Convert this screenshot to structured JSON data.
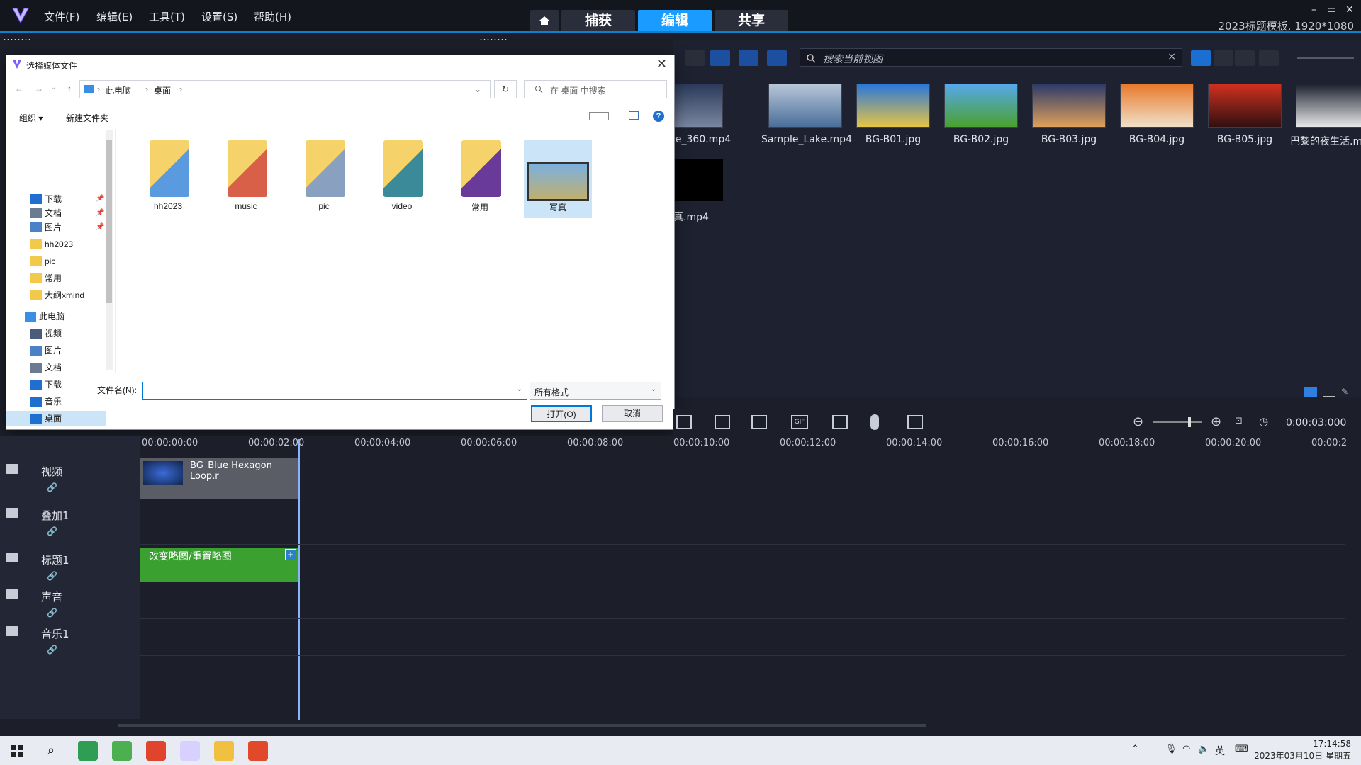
{
  "app": {
    "menu": [
      "文件(F)",
      "编辑(E)",
      "工具(T)",
      "设置(S)",
      "帮助(H)"
    ],
    "tabs": [
      {
        "label": "捕获",
        "active": false
      },
      {
        "label": "编辑",
        "active": true
      },
      {
        "label": "共享",
        "active": false
      }
    ],
    "project_info": "2023标题模板, 1920*1080",
    "accent": "#1a9bff"
  },
  "library": {
    "search_placeholder": "搜索当前视图",
    "items": [
      {
        "label": "e_360.mp4",
        "colors": [
          "#2b3a5a",
          "#7a86a0"
        ]
      },
      {
        "label": "Sample_Lake.mp4",
        "colors": [
          "#b8c6d8",
          "#4a6f9a"
        ]
      },
      {
        "label": "BG-B01.jpg",
        "colors": [
          "#2a78d8",
          "#e6c447"
        ]
      },
      {
        "label": "BG-B02.jpg",
        "colors": [
          "#56a8ea",
          "#4aa12e"
        ]
      },
      {
        "label": "BG-B03.jpg",
        "colors": [
          "#2c3a6a",
          "#e0a05a"
        ]
      },
      {
        "label": "BG-B04.jpg",
        "colors": [
          "#e87a2c",
          "#f0e0c8"
        ]
      },
      {
        "label": "BG-B05.jpg",
        "colors": [
          "#d03020",
          "#301010"
        ]
      },
      {
        "label": "巴黎的夜生活.mp3",
        "colors": [
          "#1e2230",
          "#e8e8e8"
        ]
      }
    ],
    "second_row_label": "真.mp4"
  },
  "dialog": {
    "title": "选择媒体文件",
    "breadcrumb": [
      "此电脑",
      "桌面"
    ],
    "search_placeholder": "在 桌面 中搜索",
    "toolbar": {
      "organize": "组织 ▾",
      "new_folder": "新建文件夹"
    },
    "nav": [
      {
        "label": "下载",
        "icon": "download-icon",
        "pinned": true
      },
      {
        "label": "文档",
        "icon": "document-icon",
        "pinned": true
      },
      {
        "label": "图片",
        "icon": "picture-icon",
        "pinned": true
      },
      {
        "label": "hh2023",
        "icon": "folder-icon",
        "pinned": false
      },
      {
        "label": "pic",
        "icon": "folder-icon",
        "pinned": false
      },
      {
        "label": "常用",
        "icon": "folder-icon",
        "pinned": false
      },
      {
        "label": "大纲xmind",
        "icon": "folder-icon",
        "pinned": false
      },
      {
        "label": "此电脑",
        "icon": "computer-icon",
        "pinned": false
      },
      {
        "label": "视频",
        "icon": "video-icon",
        "pinned": false
      },
      {
        "label": "图片",
        "icon": "picture-icon",
        "pinned": false
      },
      {
        "label": "文档",
        "icon": "document-icon",
        "pinned": false
      },
      {
        "label": "下载",
        "icon": "download-icon",
        "pinned": false
      },
      {
        "label": "音乐",
        "icon": "music-icon",
        "pinned": false
      },
      {
        "label": "桌面",
        "icon": "desktop-icon",
        "pinned": false
      }
    ],
    "files": [
      {
        "label": "hh2023",
        "type": "folder"
      },
      {
        "label": "music",
        "type": "folder"
      },
      {
        "label": "pic",
        "type": "folder"
      },
      {
        "label": "video",
        "type": "folder"
      },
      {
        "label": "常用",
        "type": "folder"
      },
      {
        "label": "写真",
        "type": "video"
      }
    ],
    "filename_label": "文件名(N):",
    "filename_value": "",
    "filetype": "所有格式",
    "open_button": "打开(O)",
    "cancel_button": "取消"
  },
  "timeline": {
    "ruler": [
      "00:00:00:00",
      "00:00:02:00",
      "00:00:04:00",
      "00:00:06:00",
      "00:00:08:00",
      "00:00:10:00",
      "00:00:12:00",
      "00:00:14:00",
      "00:00:16:00",
      "00:00:18:00",
      "00:00:20:00",
      "00:00:2"
    ],
    "timecode": "0:00:03:000",
    "tracks": [
      {
        "name": "视频",
        "clip": "BG_Blue Hexagon Loop.r"
      },
      {
        "name": "叠加1",
        "clip": ""
      },
      {
        "name": "标题1",
        "clip": "改变略图/重置略图"
      },
      {
        "name": "声音",
        "clip": ""
      },
      {
        "name": "音乐1",
        "clip": ""
      }
    ]
  },
  "taskbar": {
    "time": "17:14:58",
    "date": "2023年03月10日 星期五",
    "ime": "英"
  }
}
